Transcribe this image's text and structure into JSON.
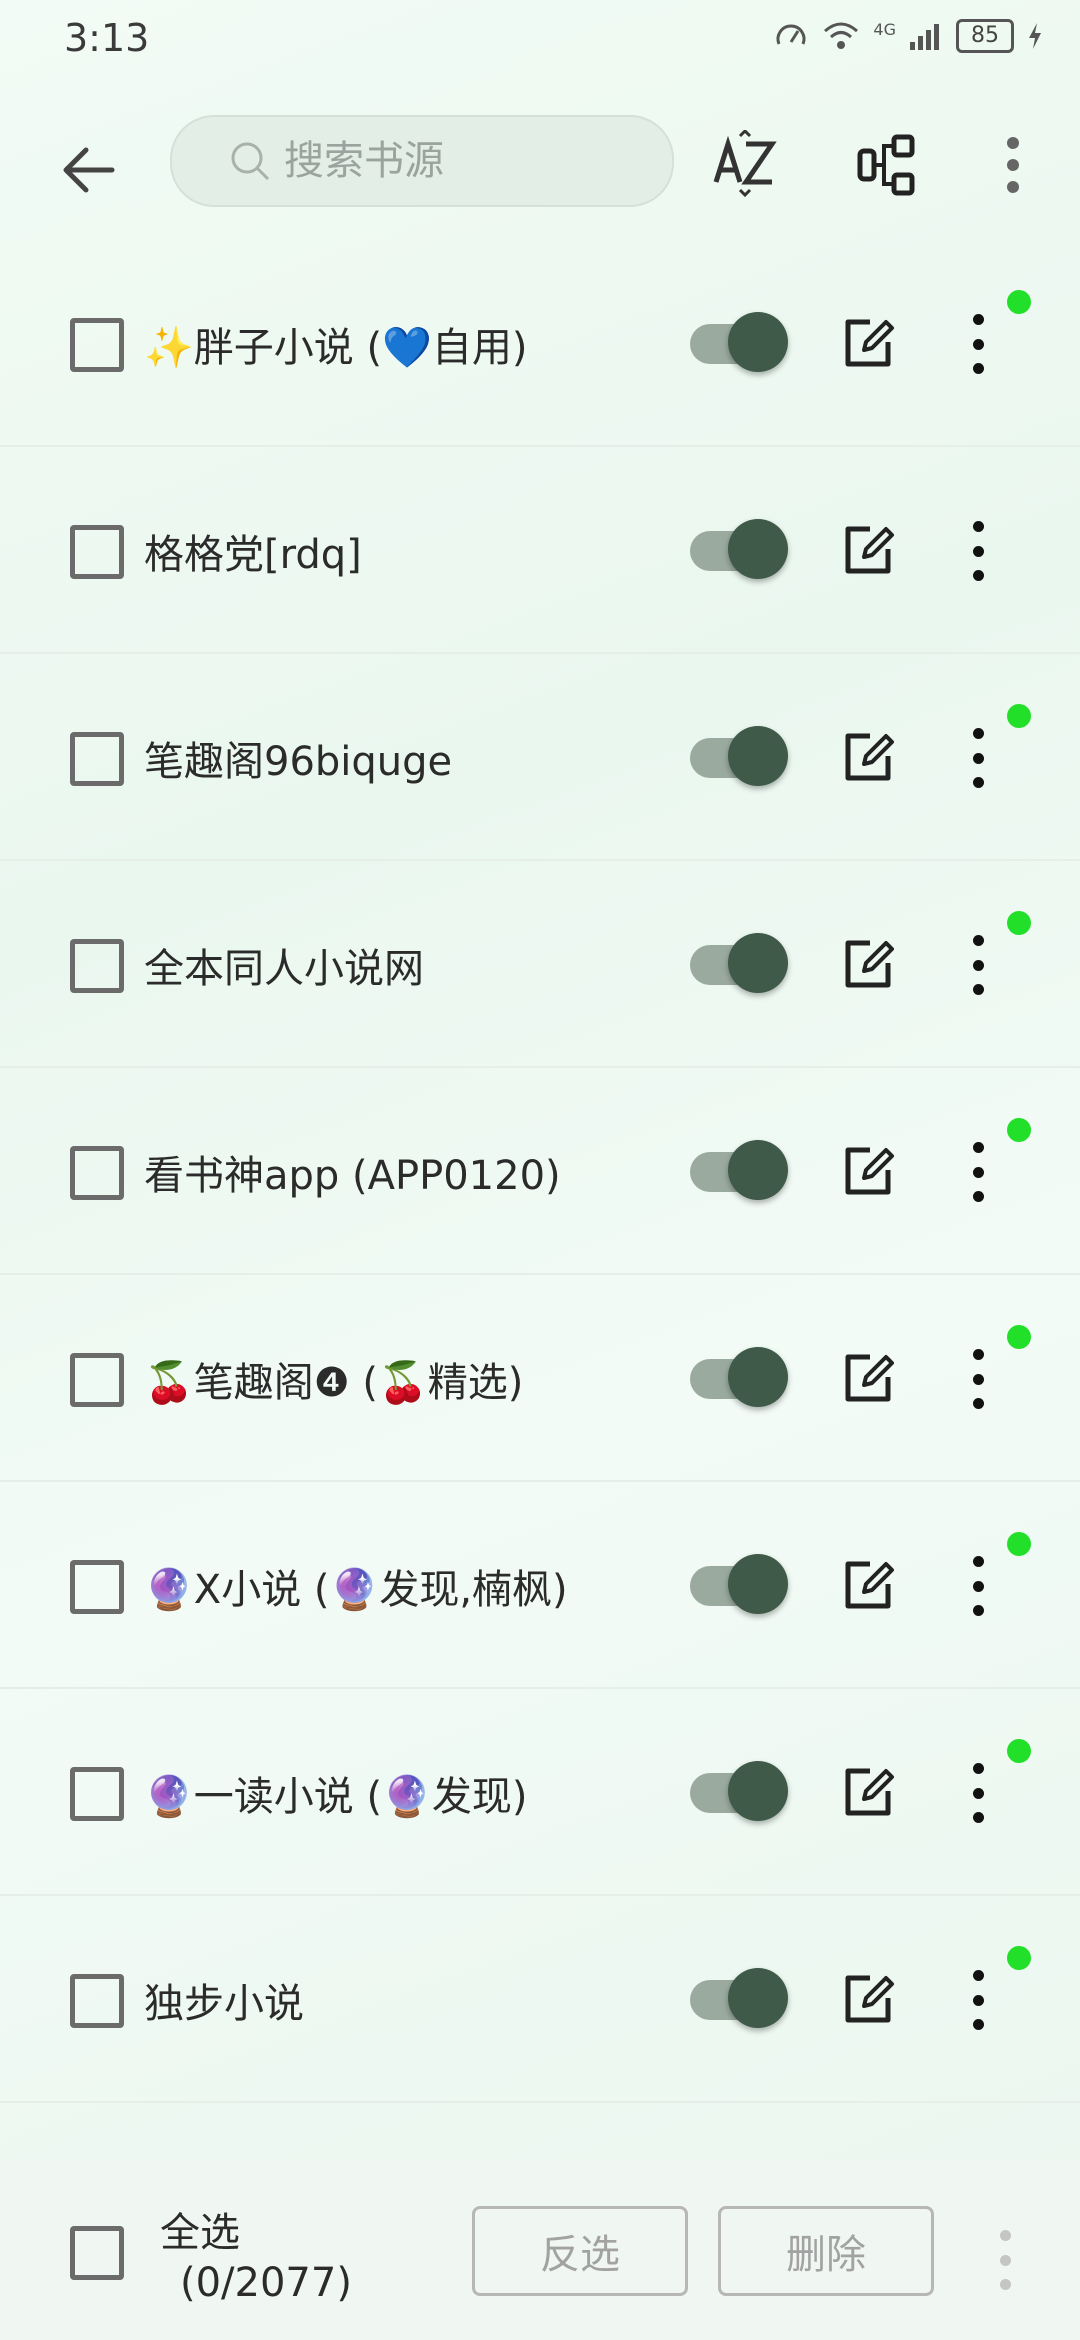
{
  "status": {
    "time": "3:13",
    "battery": "85",
    "network": "4G"
  },
  "toolbar": {
    "search_placeholder": "搜索书源"
  },
  "sources": [
    {
      "label": "✨胖子小说 (💙自用)",
      "enabled": true,
      "has_dot": true
    },
    {
      "label": "格格党[rdq]",
      "enabled": true,
      "has_dot": false
    },
    {
      "label": "笔趣阁96biquge",
      "enabled": true,
      "has_dot": true
    },
    {
      "label": "全本同人小说网",
      "enabled": true,
      "has_dot": true
    },
    {
      "label": "看书神app (APP0120)",
      "enabled": true,
      "has_dot": true
    },
    {
      "label": "🍒笔趣阁❹ (🍒精选)",
      "enabled": true,
      "has_dot": true
    },
    {
      "label": "🔮X小说 (🔮发现,楠枫)",
      "enabled": true,
      "has_dot": true
    },
    {
      "label": "🔮一读小说 (🔮发现)",
      "enabled": true,
      "has_dot": true
    },
    {
      "label": "独步小说",
      "enabled": true,
      "has_dot": true
    }
  ],
  "bottom": {
    "select_all": "全选",
    "count": "(0/2077)",
    "invert": "反选",
    "delete": "删除"
  },
  "colors": {
    "accent": "#3f5a48",
    "indicator": "#22e02a",
    "track": "#9aaa9f"
  }
}
